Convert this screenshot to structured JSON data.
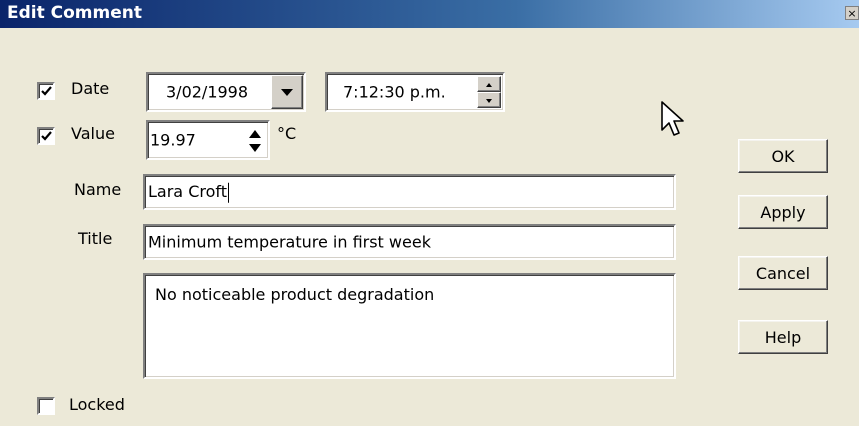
{
  "window": {
    "title": "Edit Comment",
    "close_glyph": "×"
  },
  "date": {
    "checkbox_label": "Date",
    "checked": true,
    "value": "3/02/1998",
    "time": "7:12:30 p.m."
  },
  "value": {
    "checkbox_label": "Value",
    "checked": true,
    "number": "19.97",
    "unit": "°C"
  },
  "name": {
    "label": "Name",
    "value": "Lara Croft"
  },
  "title": {
    "label": "Title",
    "value": "Minimum temperature in first week"
  },
  "comment": {
    "value": "No noticeable product degradation"
  },
  "locked": {
    "label": "Locked",
    "checked": false
  },
  "buttons": {
    "ok": "OK",
    "apply": "Apply",
    "cancel": "Cancel",
    "help": "Help"
  },
  "icons": {
    "check": "check-icon",
    "dropdown": "chevron-down-icon",
    "spin_up": "triangle-up-icon",
    "spin_down": "triangle-down-icon",
    "cursor": "mouse-pointer-icon"
  }
}
